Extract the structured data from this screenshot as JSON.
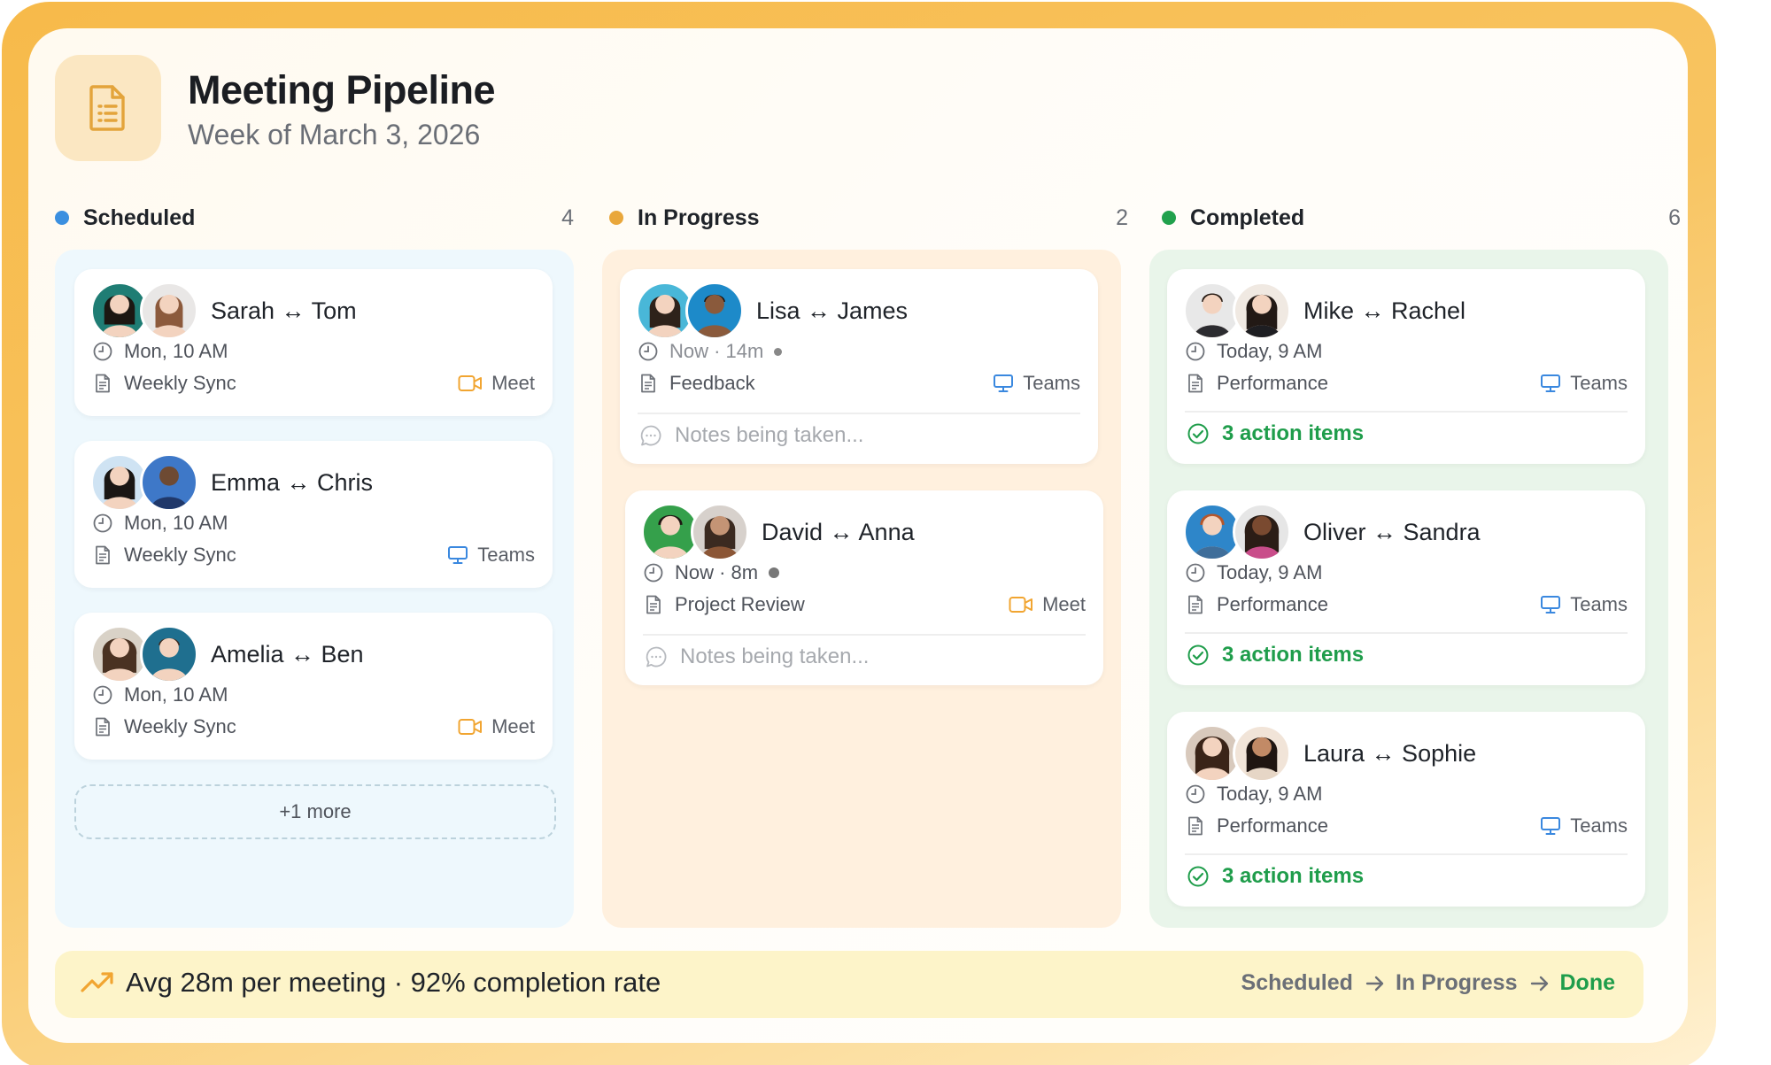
{
  "header": {
    "title": "Meeting Pipeline",
    "subtitle": "Week of March 3, 2026"
  },
  "columns": [
    {
      "label": "Scheduled",
      "count": "4",
      "color": "#3b8fe0"
    },
    {
      "label": "In Progress",
      "count": "2",
      "color": "#e9a73b"
    },
    {
      "label": "Completed",
      "count": "6",
      "color": "#21a14d"
    }
  ],
  "scheduled": [
    {
      "title": "Sarah ↔ Tom",
      "time": "Mon, 10 AM",
      "type": "Weekly Sync",
      "platform": "Meet"
    },
    {
      "title": "Emma ↔ Chris",
      "time": "Mon, 10 AM",
      "type": "Weekly Sync",
      "platform": "Teams"
    },
    {
      "title": "Amelia ↔ Ben",
      "time": "Mon, 10 AM",
      "type": "Weekly Sync",
      "platform": "Meet"
    }
  ],
  "scheduled_more": "+1 more",
  "in_progress": [
    {
      "title": "Lisa ↔ James",
      "time": "Now · 14m",
      "type": "Feedback",
      "platform": "Teams",
      "notes": "Notes being taken..."
    },
    {
      "title": "David ↔ Anna",
      "time": "Now · 8m",
      "type": "Project Review",
      "platform": "Meet",
      "notes": "Notes being taken..."
    }
  ],
  "completed": [
    {
      "title": "Mike ↔ Rachel",
      "time": "Today, 9 AM",
      "type": "Performance",
      "platform": "Teams",
      "actions": "3 action items"
    },
    {
      "title": "Oliver ↔ Sandra",
      "time": "Today, 9 AM",
      "type": "Performance",
      "platform": "Teams",
      "actions": "3 action items"
    },
    {
      "title": "Laura ↔ Sophie",
      "time": "Today, 9 AM",
      "type": "Performance",
      "platform": "Teams",
      "actions": "3 action items"
    }
  ],
  "footer": {
    "stat": "Avg 28m per meeting · 92% completion rate",
    "flow": [
      "Scheduled",
      "In Progress",
      "Done"
    ]
  },
  "icons": {
    "header": "document-list-icon",
    "time": "clock-icon",
    "type": "document-icon",
    "meet": "video-camera-icon",
    "teams": "monitor-icon",
    "notes": "chat-bubble-icon",
    "actions": "check-circle-icon",
    "footer": "trending-up-icon"
  },
  "colors": {
    "accent": "#f7ba4a",
    "scheduled_bg": "#eef8fd",
    "progress_bg": "#fff0de",
    "completed_bg": "#e9f5ea",
    "success": "#1f9d4b"
  }
}
